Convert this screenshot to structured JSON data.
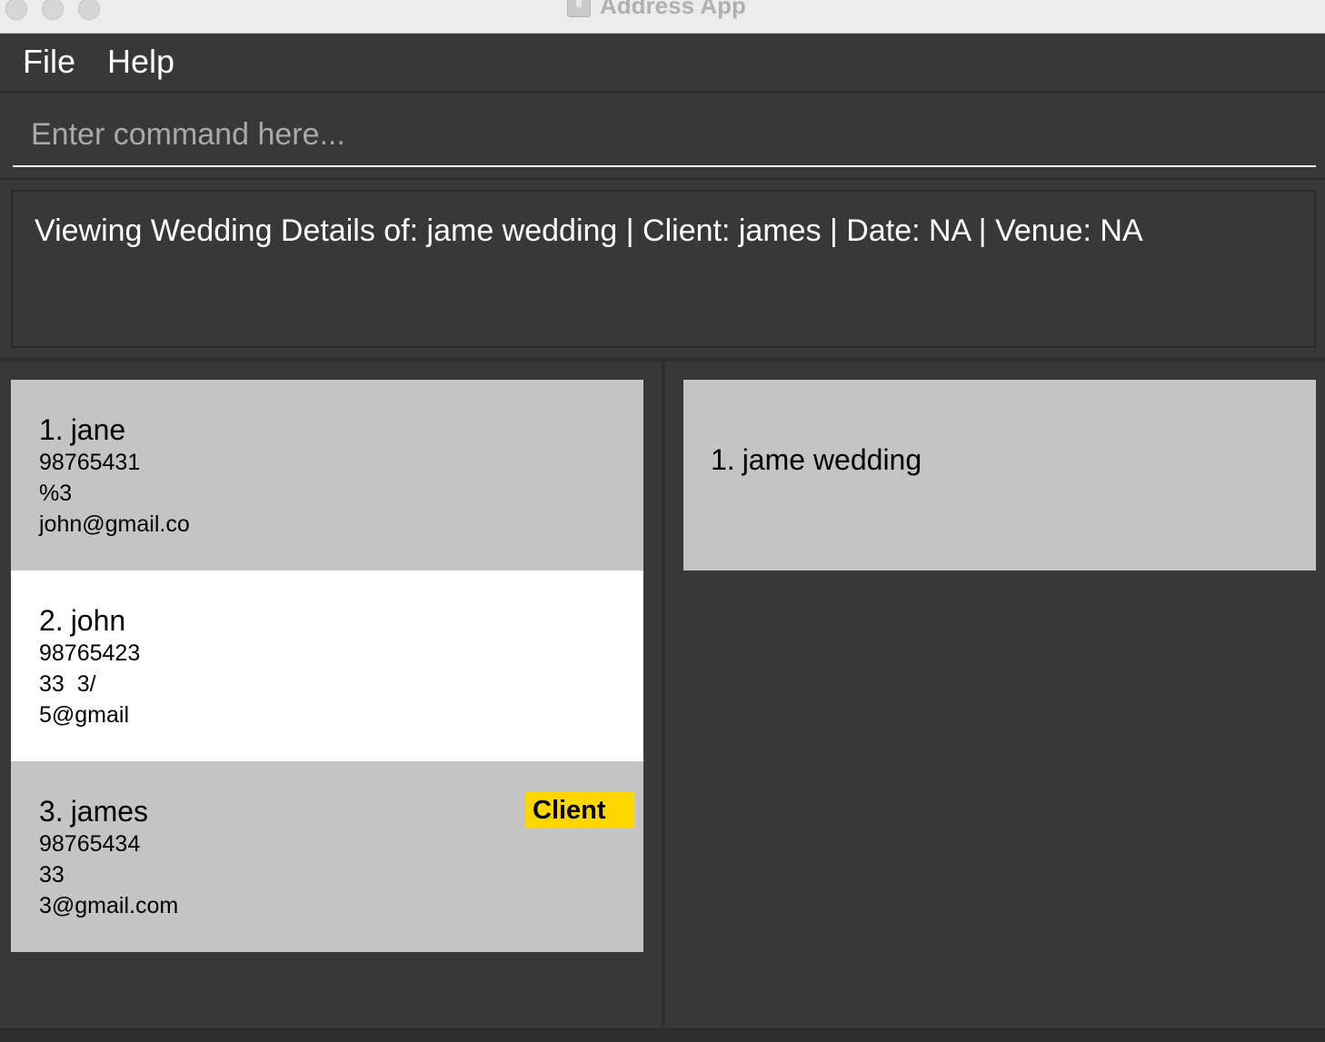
{
  "window": {
    "title": "Address App"
  },
  "menu": {
    "file": "File",
    "help": "Help"
  },
  "command": {
    "placeholder": "Enter command here..."
  },
  "result": {
    "text": "Viewing Wedding Details of: jame wedding | Client: james | Date: NA | Venue: NA"
  },
  "persons": [
    {
      "index": "1.",
      "name": "jane",
      "phone": "98765431",
      "address": "%3",
      "email": "john@gmail.co",
      "tag": ""
    },
    {
      "index": "2.",
      "name": "john",
      "phone": "98765423",
      "address": "33  3/",
      "email": "5@gmail",
      "tag": ""
    },
    {
      "index": "3.",
      "name": "james",
      "phone": "98765434",
      "address": "33",
      "email": "3@gmail.com",
      "tag": "Client"
    }
  ],
  "weddings": [
    {
      "index": "1.",
      "name": "jame wedding"
    }
  ],
  "status": {
    "text": ""
  },
  "colors": {
    "background": "#383838",
    "card": "#c4c4c4",
    "selected_card": "#ffffff",
    "tag": "#ffd700"
  }
}
